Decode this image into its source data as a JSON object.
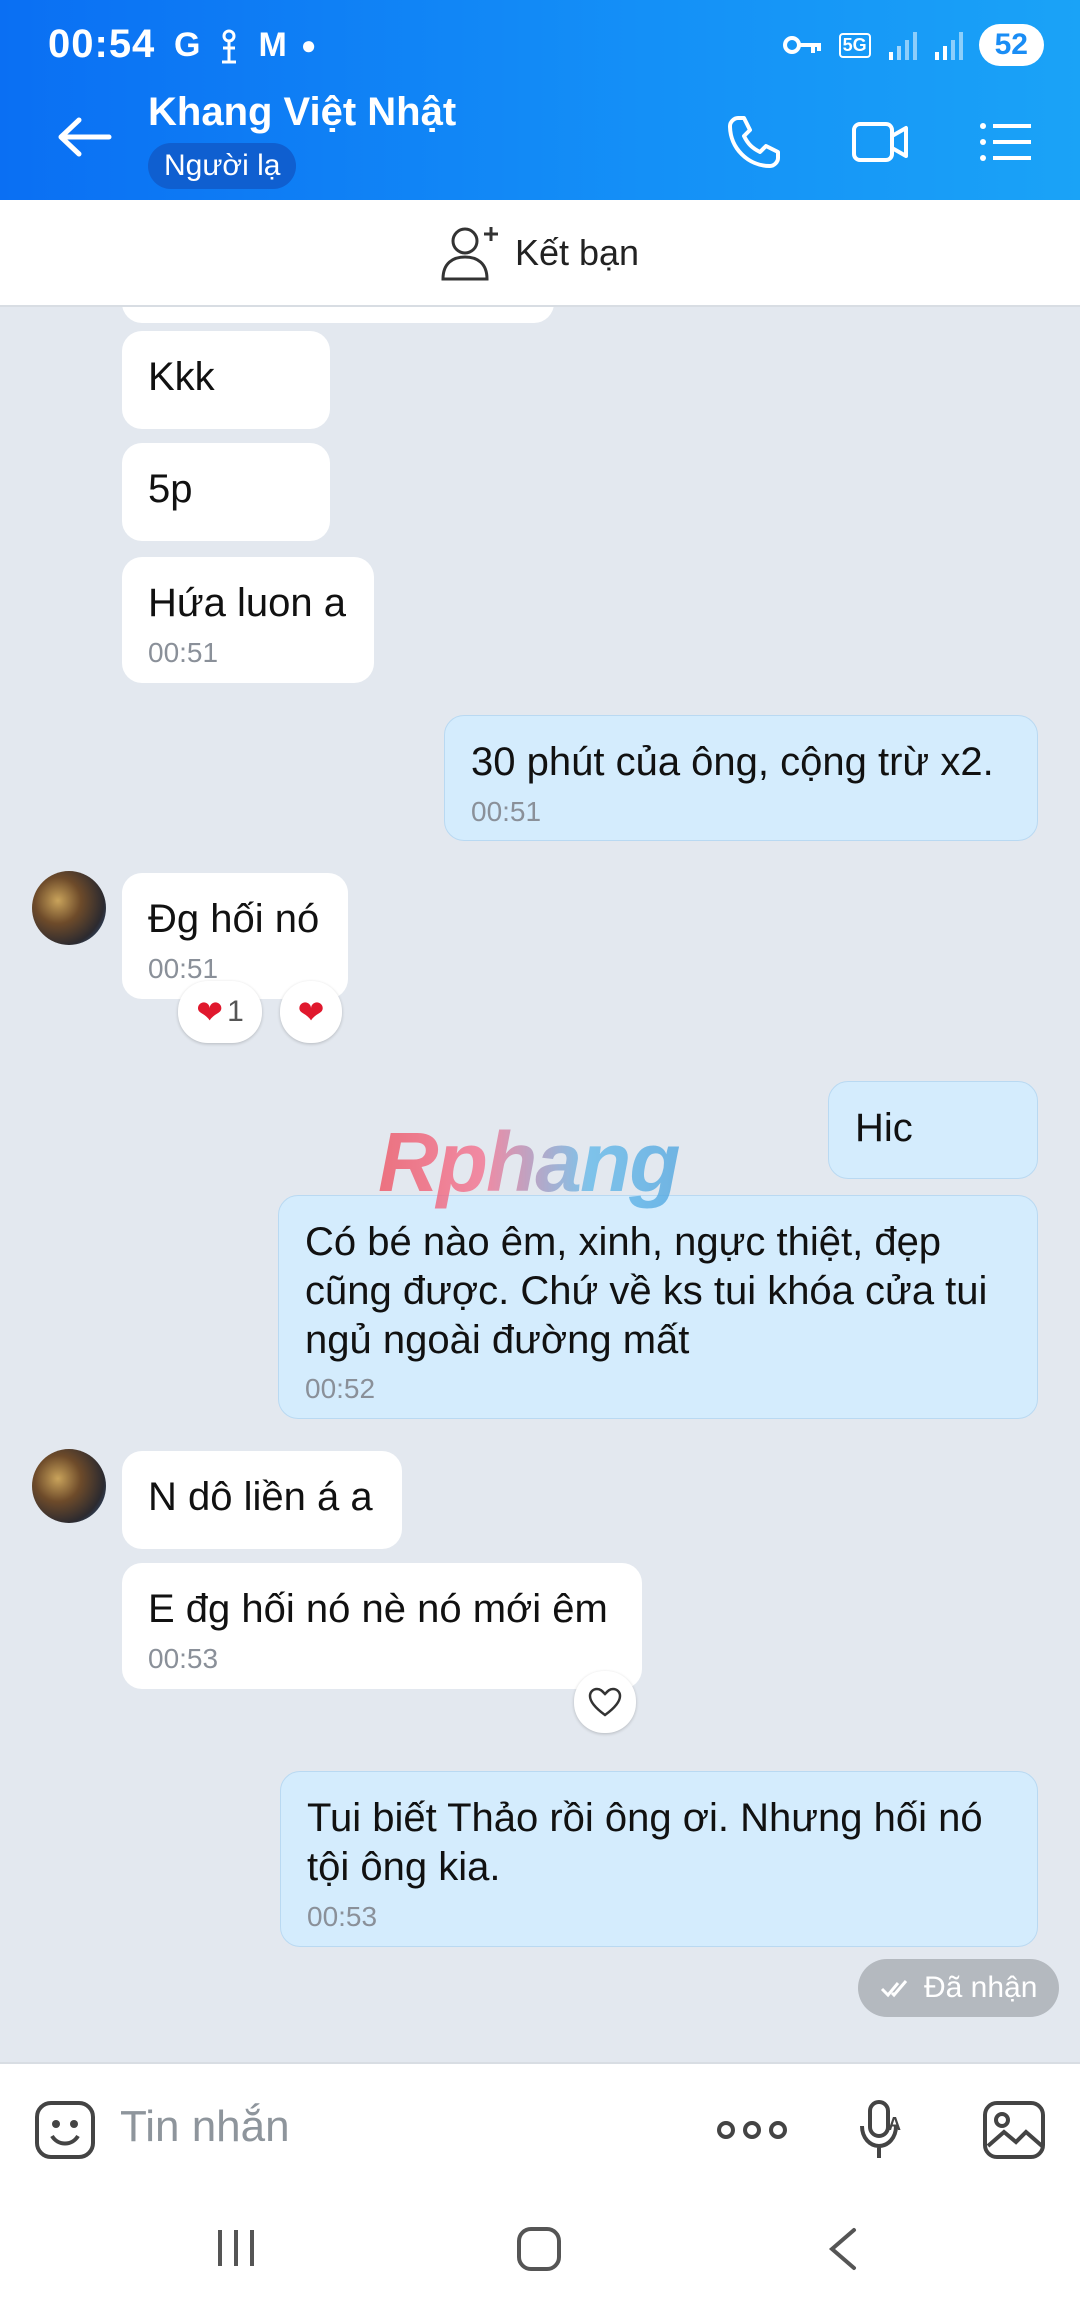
{
  "status_bar": {
    "time": "00:54",
    "left_icons": [
      "G",
      "M"
    ],
    "network": "5G",
    "battery": "52"
  },
  "header": {
    "contact_name": "Khang Việt Nhật",
    "badge": "Người lạ"
  },
  "add_friend": {
    "label": "Kết bạn"
  },
  "messages": [
    {
      "label": "Kkk"
    },
    {
      "label": "5p"
    },
    {
      "label": "Hứa luon a",
      "time": "00:51"
    },
    {
      "label": "30 phút của ông, cộng trừ x2.",
      "time": "00:51"
    },
    {
      "label": "Đg hối nó",
      "time": "00:51",
      "reaction_count": "1"
    },
    {
      "label": "Hic"
    },
    {
      "label": "Có bé nào êm, xinh, ngực thiệt, đẹp cũng được. Chứ về ks tui khóa cửa tui ngủ ngoài đường mất",
      "time": "00:52"
    },
    {
      "label": "N dô liền á a"
    },
    {
      "label": "E đg hối nó nè nó mới êm",
      "time": "00:53"
    },
    {
      "label": "Tui biết Thảo rồi ông ơi. Nhưng hối nó tội ông kia.",
      "time": "00:53"
    }
  ],
  "received_status": "Đã nhận",
  "watermark": "Rphang",
  "input": {
    "placeholder": "Tin nhắn"
  },
  "colors": {
    "header_start": "#0a6ff3",
    "header_end": "#1aa3f7",
    "sent_bubble": "#d4ecfd",
    "received_bubble": "#ffffff",
    "chat_bg": "#e3e8ef",
    "heart": "#e0182d"
  },
  "icons": [
    "back-arrow-icon",
    "phone-icon",
    "video-call-icon",
    "menu-list-icon",
    "add-friend-icon",
    "heart-icon",
    "emoji-icon",
    "more-icon",
    "voice-text-icon",
    "image-icon"
  ]
}
